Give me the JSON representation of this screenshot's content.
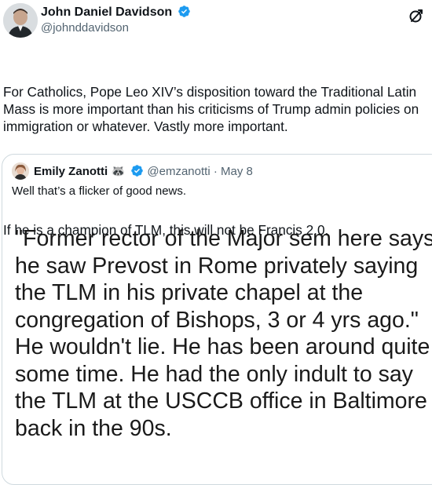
{
  "author": {
    "name": "John Daniel Davidson",
    "handle": "@johnddavidson"
  },
  "tweet": {
    "paragraph1": "For Catholics, Pope Leo XIV’s disposition toward the Traditional Latin Mass is more important than his criticisms of Trump admin policies on immigration or whatever. Vastly more important.",
    "paragraph2": "If he is a champion of TLM, this will not be Francis 2.0."
  },
  "quoted": {
    "name": "Emily Zanotti",
    "emoji": "🦝",
    "handle": "@emzanotti",
    "separator": "·",
    "date": "May 8",
    "text": "Well that’s a flicker of good news.",
    "image_text": "\"Former rector of the Major sem here says he saw Prevost in Rome privately saying the TLM in his private chapel at the congregation of Bishops, 3 or 4 yrs ago.\" He wouldn't lie. He has been around quite some time. He had the only indult to say the TLM at the USCCB office in Baltimore back in the 90s."
  },
  "colors": {
    "verified": "#1d9bf0",
    "secondary_text": "#536471",
    "border": "#cfd9de"
  },
  "icons": {
    "verified": "verified-badge-icon",
    "grok": "grok-icon"
  }
}
